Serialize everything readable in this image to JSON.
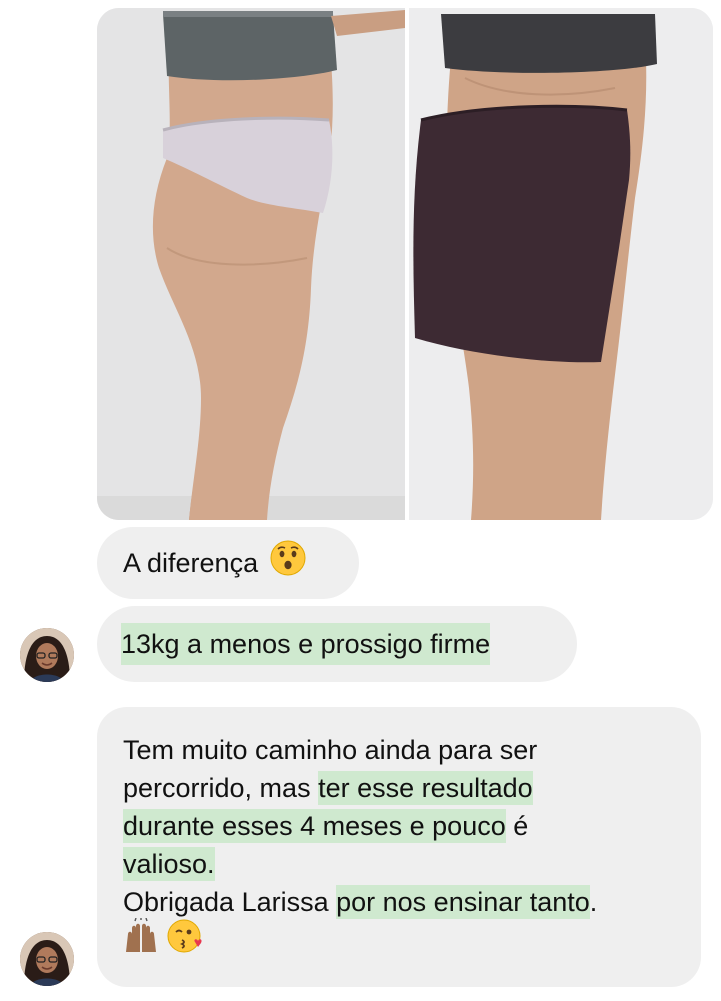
{
  "messages": [
    {
      "type": "image",
      "images": [
        {
          "label": "before-photo"
        },
        {
          "label": "after-photo"
        }
      ]
    },
    {
      "type": "text",
      "text": "A diferença",
      "emoji": "surprised-face-emoji"
    },
    {
      "type": "text",
      "text": "13kg a menos e prossigo firme",
      "highlighted": true
    },
    {
      "type": "text",
      "lines": {
        "l1": "Tem muito caminho ainda para ser",
        "l2a": "percorrido, mas ",
        "l2b": "ter esse resultado",
        "l3a": "durante esses 4 meses e pouco",
        "l3b": " é",
        "l4": "valioso.",
        "l5a": "Obrigada Larissa ",
        "l5b": "por nos ensinar tanto",
        "l5c": "."
      },
      "emojis": [
        "raising-hands-emoji",
        "face-blowing-kiss-emoji"
      ]
    }
  ],
  "colors": {
    "bubble": "#efefef",
    "highlight": "#cfe9cf",
    "text": "#111111",
    "background": "#ffffff"
  }
}
